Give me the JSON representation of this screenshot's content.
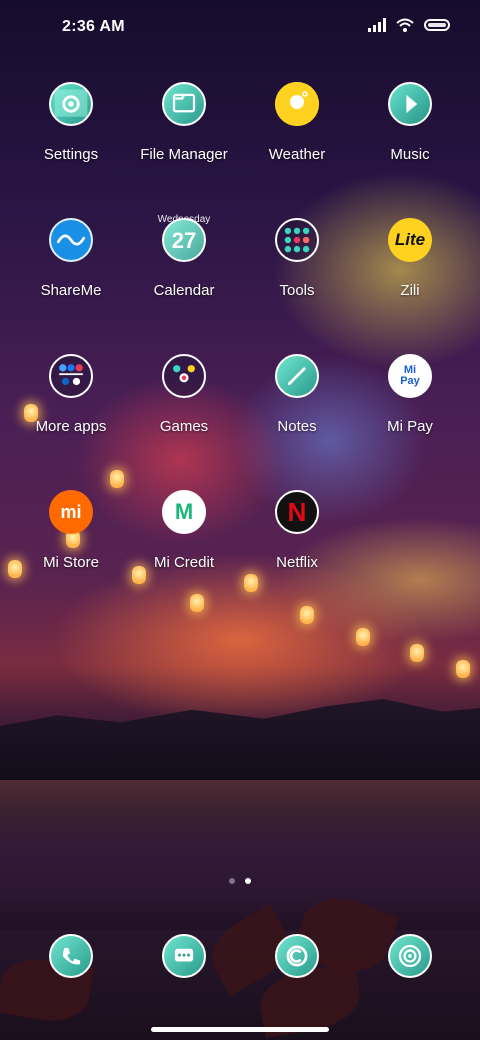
{
  "status_bar": {
    "time": "2:36 AM"
  },
  "apps": [
    {
      "label": "Settings",
      "icon": "settings-icon"
    },
    {
      "label": "File Manager",
      "icon": "file-manager-icon"
    },
    {
      "label": "Weather",
      "icon": "weather-icon"
    },
    {
      "label": "Music",
      "icon": "music-icon"
    },
    {
      "label": "ShareMe",
      "icon": "shareme-icon"
    },
    {
      "label": "Calendar",
      "icon": "calendar-icon",
      "day_name": "Wednesday",
      "date": "27"
    },
    {
      "label": "Tools",
      "icon": "tools-folder-icon"
    },
    {
      "label": "Zili",
      "icon": "zili-icon",
      "icon_text": "Lite"
    },
    {
      "label": "More apps",
      "icon": "more-apps-folder-icon"
    },
    {
      "label": "Games",
      "icon": "games-folder-icon"
    },
    {
      "label": "Notes",
      "icon": "notes-icon"
    },
    {
      "label": "Mi Pay",
      "icon": "mi-pay-icon",
      "icon_text": "Mi Pay"
    },
    {
      "label": "Mi Store",
      "icon": "mi-store-icon",
      "icon_text": "mi"
    },
    {
      "label": "Mi Credit",
      "icon": "mi-credit-icon",
      "icon_text": "M"
    },
    {
      "label": "Netflix",
      "icon": "netflix-icon",
      "icon_text": "N"
    }
  ],
  "dock": [
    {
      "icon": "phone-icon"
    },
    {
      "icon": "messaging-icon"
    },
    {
      "icon": "browser-icon"
    },
    {
      "icon": "camera-icon"
    }
  ],
  "page_indicator": {
    "pages": 2,
    "current": 2
  },
  "colors": {
    "weather_yellow": "#ffd21f",
    "shareme_blue": "#1a8fe6",
    "mi_orange": "#ff6a00",
    "mi_credit_green": "#19b87a",
    "netflix_red": "#e50914",
    "teal_theme": "#3bd6c2"
  }
}
